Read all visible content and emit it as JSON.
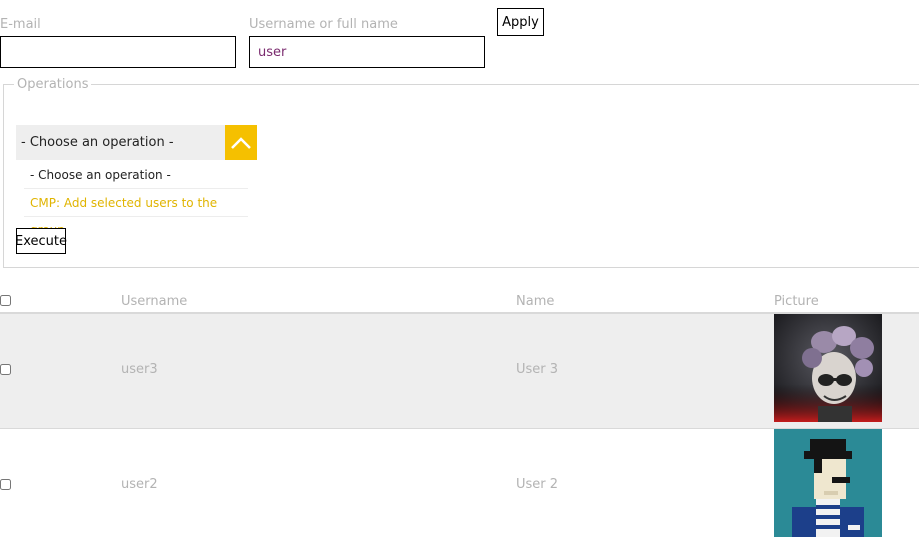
{
  "filters": {
    "email_label": "E-mail",
    "email_value": "",
    "name_label": "Username or full name",
    "name_value": "user",
    "apply_label": "Apply"
  },
  "operations": {
    "legend": "Operations",
    "selected": "- Choose an operation -",
    "options": [
      "- Choose an operation -",
      "CMP: Add selected users to the group"
    ],
    "execute_label": "Execute",
    "accent_color": "#f5c000"
  },
  "table": {
    "columns": [
      "Username",
      "Name",
      "Picture"
    ],
    "rows": [
      {
        "username": "user3",
        "name": "User 3",
        "picture": "avatar-masked-person-icon"
      },
      {
        "username": "user2",
        "name": "User 2",
        "picture": "avatar-pixel-person-icon"
      }
    ]
  }
}
